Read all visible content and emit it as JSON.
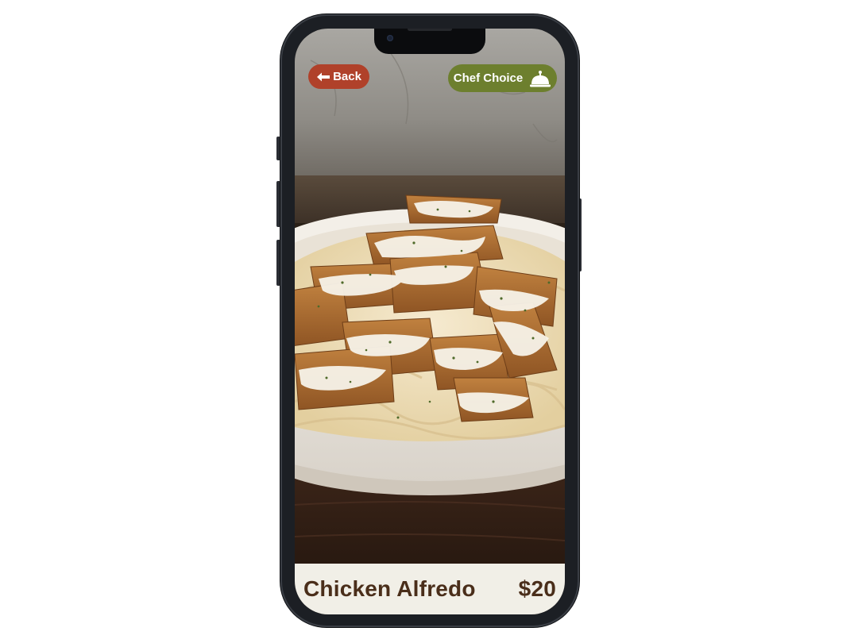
{
  "header": {
    "back_label": "Back",
    "back_icon": "left-arrow-icon",
    "badge_label": "Chef Choice",
    "badge_icon": "service-bell-icon"
  },
  "dish": {
    "name": "Chicken Alfredo",
    "price": "$20",
    "photo": "food-photo"
  },
  "colors": {
    "back_button": "#b0412a",
    "chef_badge": "#6d7f2e",
    "info_bar_bg": "#f1efe7",
    "info_text": "#4a2e1a"
  }
}
